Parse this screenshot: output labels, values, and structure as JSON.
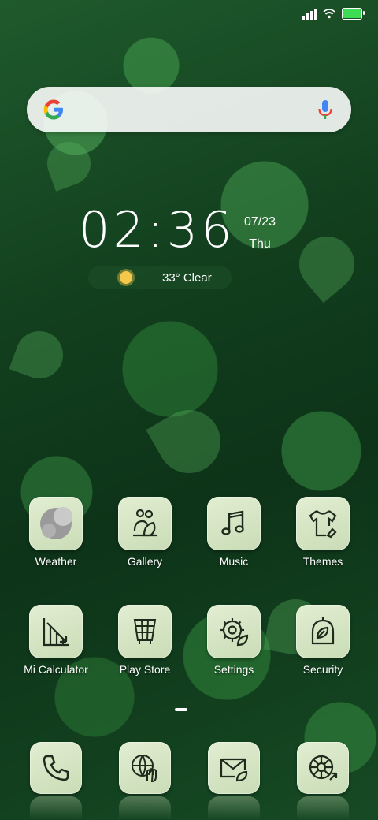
{
  "status_bar": {
    "battery_color": "#3ddc55"
  },
  "search": {
    "brand_icon": "google-g-icon",
    "mic_icon": "mic-icon"
  },
  "clock": {
    "time": "02:36",
    "date": "07/23",
    "day": "Thu"
  },
  "weather": {
    "icon": "sun-icon",
    "text": "33° Clear"
  },
  "apps_row1": [
    {
      "label": "Weather",
      "icon": "weather-icon"
    },
    {
      "label": "Gallery",
      "icon": "gallery-icon"
    },
    {
      "label": "Music",
      "icon": "music-note-icon"
    },
    {
      "label": "Themes",
      "icon": "tshirt-icon"
    }
  ],
  "apps_row2": [
    {
      "label": "Mi Calculator",
      "icon": "calculator-icon"
    },
    {
      "label": "Play Store",
      "icon": "store-grid-icon"
    },
    {
      "label": "Settings",
      "icon": "gear-leaf-icon"
    },
    {
      "label": "Security",
      "icon": "shield-leaf-icon"
    }
  ],
  "dock": [
    {
      "name": "Phone",
      "icon": "phone-icon"
    },
    {
      "name": "Browser",
      "icon": "globe-hand-icon"
    },
    {
      "name": "Messages",
      "icon": "mail-leaf-icon"
    },
    {
      "name": "Camera",
      "icon": "camera-icon"
    }
  ]
}
